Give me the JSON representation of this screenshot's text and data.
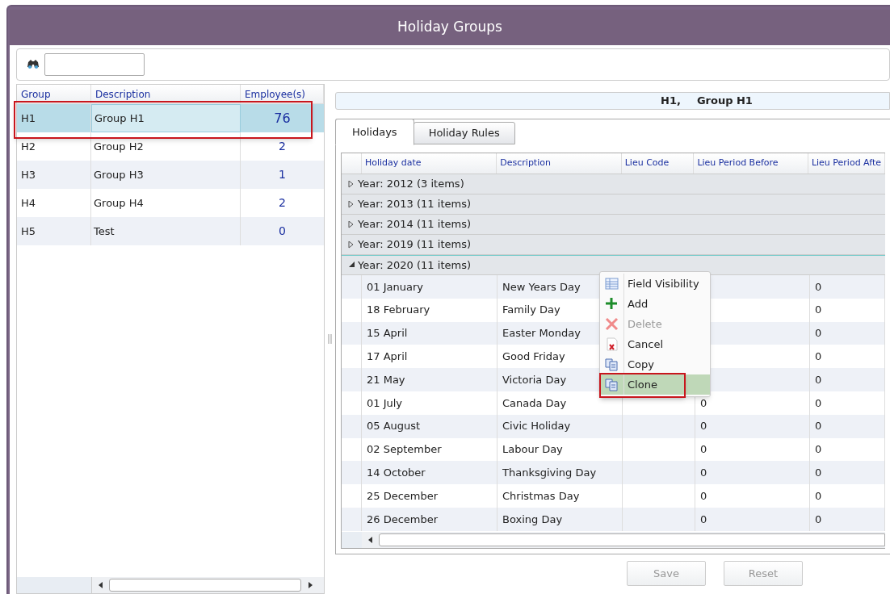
{
  "window": {
    "title": "Holiday Groups"
  },
  "groups": {
    "columns": [
      "Group",
      "Description",
      "Employee(s)"
    ],
    "rows": [
      {
        "group": "H1",
        "description": "Group H1",
        "employees": "76",
        "selected": true
      },
      {
        "group": "H2",
        "description": "Group H2",
        "employees": "2",
        "selected": false
      },
      {
        "group": "H3",
        "description": "Group H3",
        "employees": "1",
        "selected": false
      },
      {
        "group": "H4",
        "description": "Group H4",
        "employees": "2",
        "selected": false
      },
      {
        "group": "H5",
        "description": "Test",
        "employees": "0",
        "selected": false
      }
    ]
  },
  "detail_header": {
    "code": "H1,",
    "name": "Group H1"
  },
  "tabs": [
    {
      "label": "Holidays",
      "selected": true
    },
    {
      "label": "Holiday Rules",
      "selected": false
    }
  ],
  "holidays": {
    "columns": [
      "Holiday date",
      "Description",
      "Lieu Code",
      "Lieu Period Before",
      "Lieu Period Afte"
    ],
    "year_groups": [
      {
        "label": "Year: 2012 (3 items)",
        "expanded": false
      },
      {
        "label": "Year: 2013 (11 items)",
        "expanded": false
      },
      {
        "label": "Year: 2014 (11 items)",
        "expanded": false
      },
      {
        "label": "Year: 2019 (11 items)",
        "expanded": false
      },
      {
        "label": "Year: 2020 (11 items)",
        "expanded": true,
        "rows": [
          {
            "date": "01 January",
            "description": "New Years Day",
            "lieu_after": "0"
          },
          {
            "date": "18 February",
            "description": "Family Day",
            "lieu_after": "0"
          },
          {
            "date": "15 April",
            "description": "Easter Monday",
            "lieu_after": "0"
          },
          {
            "date": "17 April",
            "description": "Good Friday",
            "lieu_after": "0"
          },
          {
            "date": "21 May",
            "description": "Victoria Day",
            "lieu_after": "0"
          },
          {
            "date": "01 July",
            "description": "Canada Day",
            "lieu_before": "0",
            "lieu_after": "0"
          },
          {
            "date": "05 August",
            "description": "Civic Holiday",
            "lieu_before": "0",
            "lieu_after": "0"
          },
          {
            "date": "02 September",
            "description": "Labour Day",
            "lieu_before": "0",
            "lieu_after": "0"
          },
          {
            "date": "14 October",
            "description": "Thanksgiving Day",
            "lieu_before": "0",
            "lieu_after": "0"
          },
          {
            "date": "25 December",
            "description": "Christmas Day",
            "lieu_before": "0",
            "lieu_after": "0"
          },
          {
            "date": "26 December",
            "description": "Boxing Day",
            "lieu_before": "0",
            "lieu_after": "0"
          }
        ]
      }
    ]
  },
  "context_menu": {
    "items": [
      {
        "label": "Field Visibility",
        "kind": "grid",
        "disabled": false,
        "selected": false
      },
      {
        "label": "Add",
        "kind": "add",
        "disabled": false,
        "selected": false
      },
      {
        "label": "Delete",
        "kind": "delete",
        "disabled": true,
        "selected": false
      },
      {
        "label": "Cancel",
        "kind": "cancel",
        "disabled": false,
        "selected": false
      },
      {
        "label": "Copy",
        "kind": "copy",
        "disabled": false,
        "selected": false
      },
      {
        "label": "Clone",
        "kind": "copy",
        "disabled": false,
        "selected": true
      }
    ]
  },
  "buttons": [
    {
      "label": "Save",
      "disabled": true
    },
    {
      "label": "Reset",
      "disabled": true
    }
  ]
}
